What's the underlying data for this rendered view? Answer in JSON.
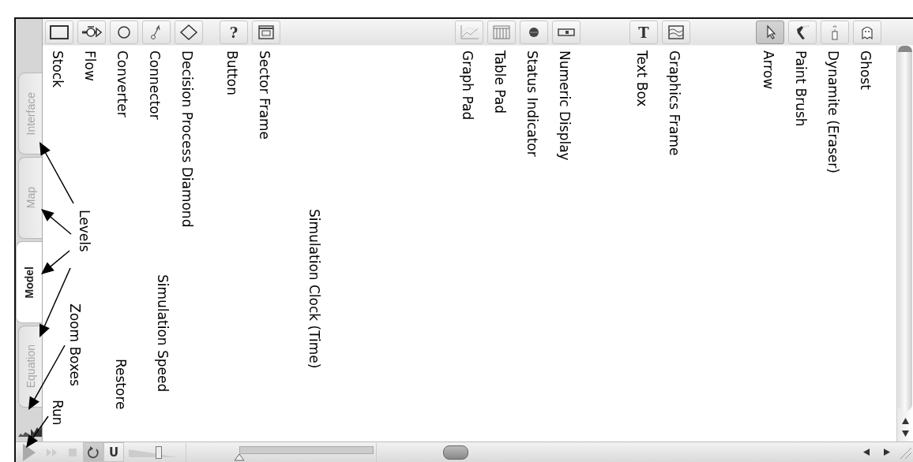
{
  "tabs": [
    {
      "label": "Interface",
      "selected": false
    },
    {
      "label": "Map",
      "selected": false
    },
    {
      "label": "Model",
      "selected": true
    },
    {
      "label": "Equation",
      "selected": false
    }
  ],
  "toolbar_groups": [
    {
      "tools": [
        {
          "kind": "stock",
          "label": "Stock",
          "selected": false
        },
        {
          "kind": "flow",
          "label": "Flow",
          "selected": false
        },
        {
          "kind": "converter",
          "label": "Converter",
          "selected": false
        },
        {
          "kind": "connector",
          "label": "Connector",
          "selected": false
        },
        {
          "kind": "diamond",
          "label": "Decision Process Diamond",
          "selected": false
        }
      ]
    },
    {
      "tools": [
        {
          "kind": "glyph",
          "glyph": "?",
          "label": "Button",
          "selected": false
        },
        {
          "kind": "sector",
          "label": "Sector Frame",
          "selected": false
        }
      ]
    },
    {
      "tools": [
        {
          "kind": "graph",
          "label": "Graph Pad",
          "selected": false
        },
        {
          "kind": "table",
          "label": "Table Pad",
          "selected": false
        },
        {
          "kind": "status",
          "label": "Status Indicator",
          "selected": false
        },
        {
          "kind": "numeric",
          "label": "Numeric Display",
          "selected": false
        }
      ]
    },
    {
      "tools": [
        {
          "kind": "glyph",
          "glyph": "T",
          "label": "Text Box",
          "selected": false
        },
        {
          "kind": "graphics",
          "label": "Graphics Frame",
          "selected": false
        }
      ]
    },
    {
      "tools": [
        {
          "kind": "arrow",
          "label": "Arrow",
          "selected": true
        },
        {
          "kind": "paint",
          "label": "Paint Brush",
          "selected": false
        },
        {
          "kind": "dynamite",
          "label": "Dynamite (Eraser)",
          "selected": false
        },
        {
          "kind": "ghost",
          "label": "Ghost",
          "selected": false
        }
      ]
    }
  ],
  "bottom_bar": {
    "controls": [
      {
        "kind": "run",
        "pressed": false
      },
      {
        "kind": "fast-forward",
        "pressed": false
      },
      {
        "kind": "stop",
        "pressed": false
      },
      {
        "kind": "restore",
        "pressed": true
      },
      {
        "kind": "glyph",
        "glyph": "U",
        "pressed": false
      }
    ],
    "speed_slider": {
      "level": 0.6
    },
    "clock_slider": {
      "level": 0
    }
  },
  "annotations": [
    {
      "text": "Levels"
    },
    {
      "text": "Zoom Boxes"
    },
    {
      "text": "Run"
    },
    {
      "text": "Restore"
    },
    {
      "text": "Simulation Speed"
    },
    {
      "text": "Simulation Clock (Time)"
    }
  ]
}
